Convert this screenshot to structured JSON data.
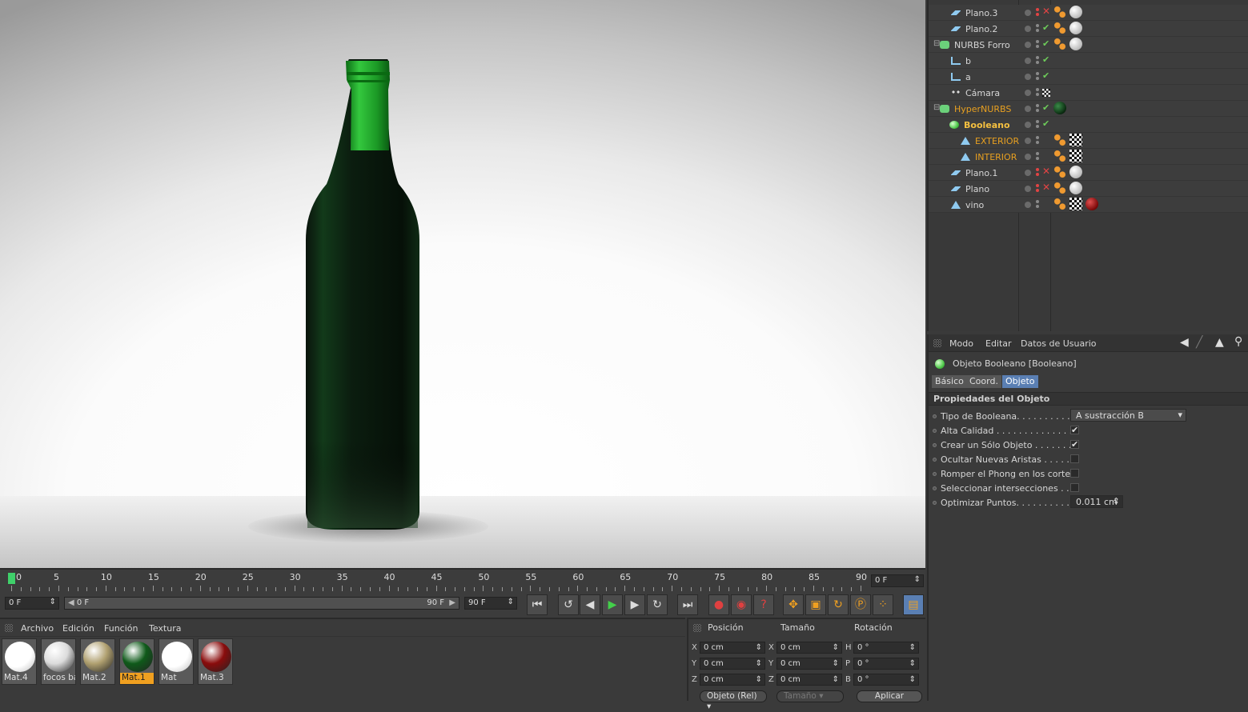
{
  "object_manager": {
    "rows": [
      {
        "name": "Plano.3",
        "color": "#d6d6d6",
        "status": "x"
      },
      {
        "name": "Plano.2",
        "color": "#d6d6d6",
        "status": "check"
      },
      {
        "name": "NURBS Forro",
        "color": "#d6d6d6",
        "status": "check"
      },
      {
        "name": "b",
        "color": "#d6d6d6",
        "status": "check"
      },
      {
        "name": "a",
        "color": "#d6d6d6",
        "status": "check"
      },
      {
        "name": "Cámara",
        "color": "#d6d6d6",
        "status": "none"
      },
      {
        "name": "HyperNURBS",
        "color": "#e8a020",
        "status": "check"
      },
      {
        "name": "Booleano",
        "color": "#f5c040",
        "status": "check"
      },
      {
        "name": "EXTERIOR",
        "color": "#e8a020",
        "status": "none"
      },
      {
        "name": "INTERIOR",
        "color": "#e8a020",
        "status": "none"
      },
      {
        "name": "Plano.1",
        "color": "#d6d6d6",
        "status": "x"
      },
      {
        "name": "Plano",
        "color": "#d6d6d6",
        "status": "x"
      },
      {
        "name": "vino",
        "color": "#d6d6d6",
        "status": "none"
      }
    ]
  },
  "attributes": {
    "menu": [
      "Modo",
      "Editar",
      "Datos de Usuario"
    ],
    "title": "Objeto Booleano [Booleano]",
    "tabs": [
      "Básico",
      "Coord.",
      "Objeto"
    ],
    "active_tab": "Objeto",
    "section": "Propiedades del Objeto",
    "props": [
      {
        "label": "Tipo de Booleana. . . . . . . . . . .",
        "type": "select",
        "value": "A sustracción B"
      },
      {
        "label": "Alta Calidad . . . . . . . . . . . . . .",
        "type": "checkbox",
        "checked": true
      },
      {
        "label": "Crear un Sólo Objeto . . . . . . .",
        "type": "checkbox",
        "checked": true
      },
      {
        "label": "Ocultar Nuevas Aristas . . . . . .",
        "type": "checkbox",
        "checked": false
      },
      {
        "label": "Romper el Phong en los cortes",
        "type": "checkbox",
        "checked": false
      },
      {
        "label": "Seleccionar intersecciones . . .",
        "type": "checkbox",
        "checked": false
      },
      {
        "label": "Optimizar Puntos. . . . . . . . . . .",
        "type": "number",
        "value": "0.011 cm"
      }
    ]
  },
  "timeline": {
    "labels": [
      "0",
      "5",
      "10",
      "15",
      "20",
      "25",
      "30",
      "35",
      "40",
      "45",
      "50",
      "55",
      "60",
      "65",
      "70",
      "75",
      "80",
      "85",
      "90"
    ],
    "current_frame": "0 F",
    "start": "0 F",
    "range_start": "0 F",
    "range_end": "90 F",
    "end": "90 F"
  },
  "materials": {
    "menu": [
      "Archivo",
      "Edición",
      "Función",
      "Textura"
    ],
    "items": [
      {
        "name": "Mat.4",
        "selected": false,
        "color": "#ffffff"
      },
      {
        "name": "focos ba",
        "selected": false,
        "color": "#dcdcdc"
      },
      {
        "name": "Mat.2",
        "selected": false,
        "color": "#b0a070"
      },
      {
        "name": "Mat.1",
        "selected": true,
        "color": "#0f5a1a"
      },
      {
        "name": "Mat",
        "selected": false,
        "color": "#ffffff"
      },
      {
        "name": "Mat.3",
        "selected": false,
        "color": "#8a0c0c"
      }
    ]
  },
  "coordinates": {
    "headers": [
      "Posición",
      "Tamaño",
      "Rotación"
    ],
    "pos": [
      {
        "axis": "X",
        "value": "0 cm"
      },
      {
        "axis": "Y",
        "value": "0 cm"
      },
      {
        "axis": "Z",
        "value": "0 cm"
      }
    ],
    "size": [
      {
        "axis": "X",
        "value": "0 cm"
      },
      {
        "axis": "Y",
        "value": "0 cm"
      },
      {
        "axis": "Z",
        "value": "0 cm"
      }
    ],
    "rot": [
      {
        "axis": "H",
        "value": "0 °"
      },
      {
        "axis": "P",
        "value": "0 °"
      },
      {
        "axis": "B",
        "value": "0 °"
      }
    ],
    "mode": "Objeto (Rel)",
    "size_mode": "Tamaño",
    "apply": "Aplicar"
  },
  "colors": {
    "accent": "#5a7fb3",
    "selected_material": "#f0a020",
    "active_object": "#e8a020"
  }
}
